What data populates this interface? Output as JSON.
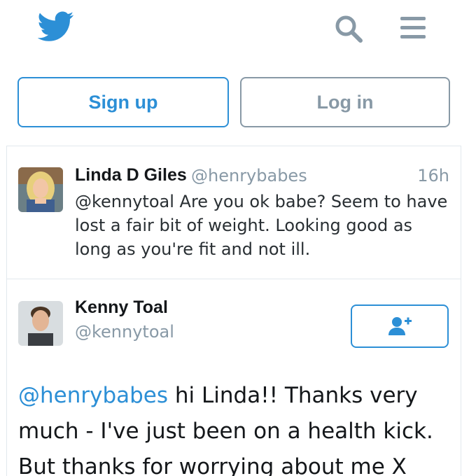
{
  "header": {
    "logo_icon": "twitter-bird-icon",
    "search_icon": "search-icon",
    "menu_icon": "hamburger-menu-icon"
  },
  "auth": {
    "signup_label": "Sign up",
    "login_label": "Log in"
  },
  "tweets": [
    {
      "name": "Linda D Giles",
      "handle": "@henrybabes",
      "time": "16h",
      "text": "@kennytoal Are you ok babe? Seem to have lost a fair bit of weight. Looking good as long as you're fit and not ill."
    },
    {
      "name": "Kenny Toal",
      "handle": "@kennytoal",
      "follow_icon": "add-user-icon",
      "mention": "@henrybabes",
      "text": " hi Linda!! Thanks very much - I've just been on a health kick. But thanks for worrying about me X"
    }
  ],
  "colors": {
    "brand_blue": "#2c8fd6",
    "muted_gray": "#8899a6",
    "border": "#e1e8ed"
  }
}
